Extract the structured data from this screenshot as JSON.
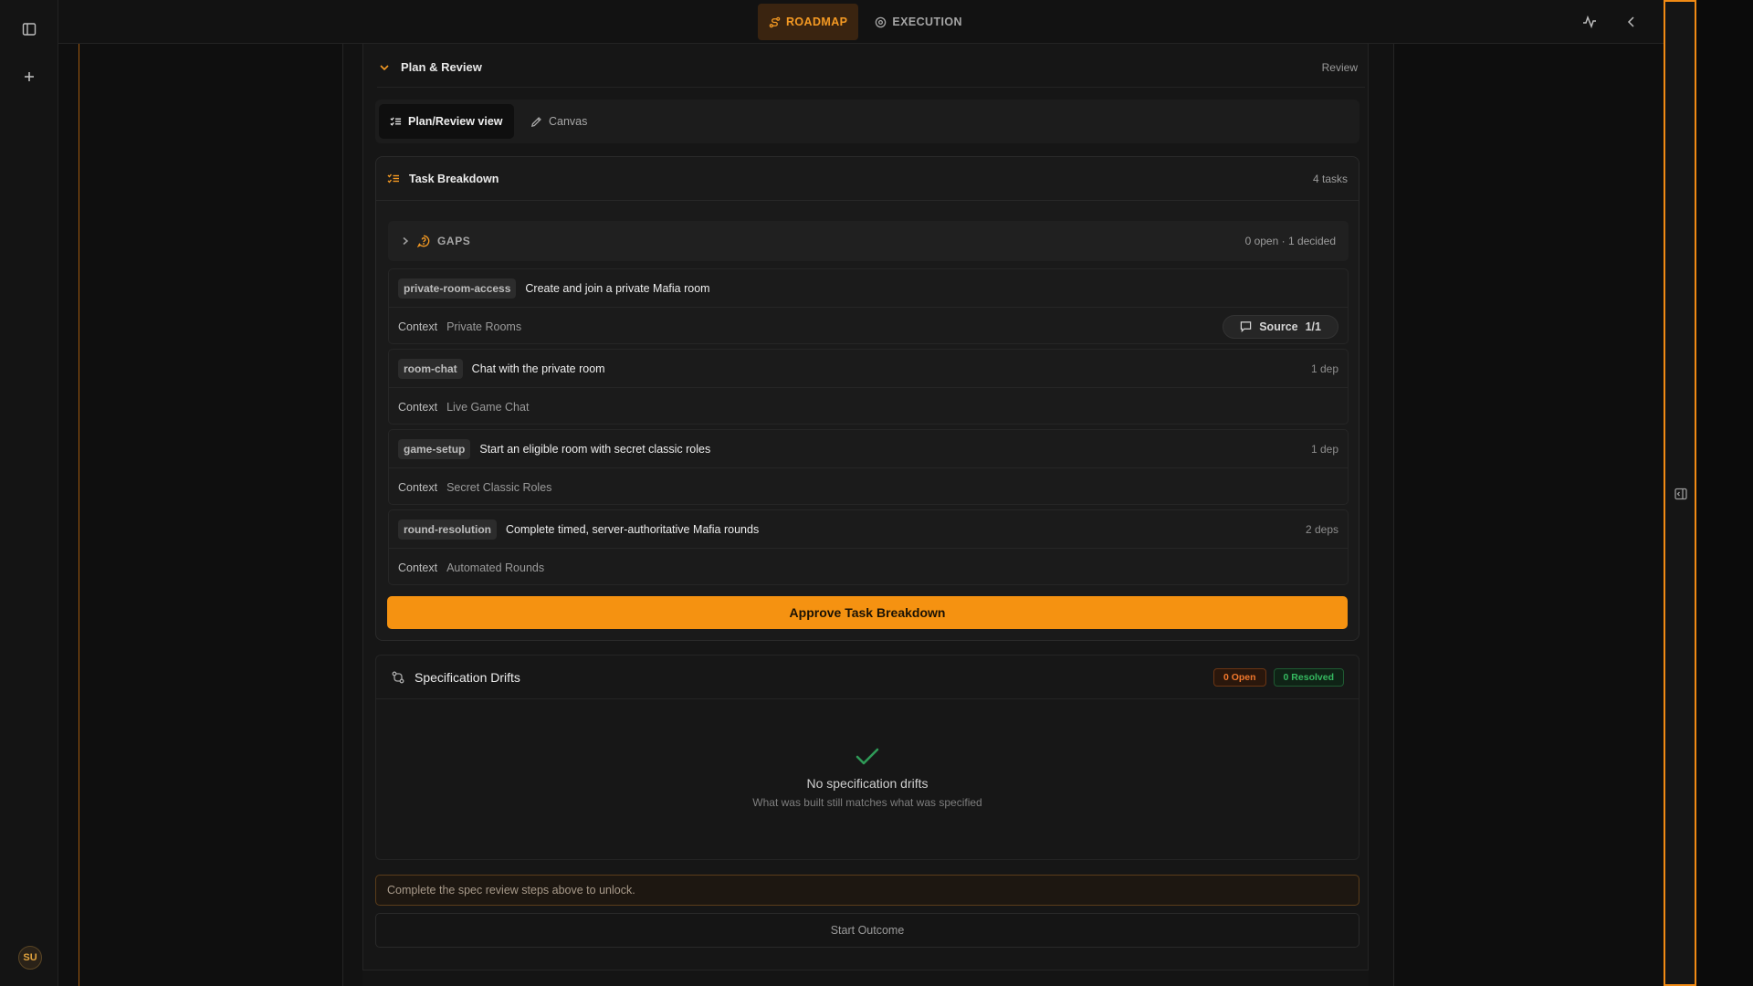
{
  "topbar": {
    "tabs": [
      {
        "label": "ROADMAP",
        "active": true
      },
      {
        "label": "EXECUTION",
        "active": false
      }
    ]
  },
  "rail": {
    "avatar_initials": "SU"
  },
  "plan_review": {
    "title": "Plan & Review",
    "right_label": "Review",
    "views": [
      {
        "label": "Plan/Review view",
        "active": true
      },
      {
        "label": "Canvas",
        "active": false
      }
    ]
  },
  "task_breakdown": {
    "title": "Task Breakdown",
    "count": "4 tasks",
    "gaps": {
      "label": "GAPS",
      "meta": "0 open · 1 decided"
    },
    "context_label": "Context",
    "tasks": [
      {
        "id": "private-room-access",
        "name": "Create and join a private Mafia room",
        "deps": "",
        "context": "Private Rooms",
        "source": "Source",
        "source_count": "1/1"
      },
      {
        "id": "room-chat",
        "name": "Chat with the private room",
        "deps": "1 dep",
        "context": "Live Game Chat"
      },
      {
        "id": "game-setup",
        "name": "Start an eligible room with secret classic roles",
        "deps": "1 dep",
        "context": "Secret Classic Roles"
      },
      {
        "id": "round-resolution",
        "name": "Complete timed, server-authoritative Mafia rounds",
        "deps": "2 deps",
        "context": "Automated Rounds"
      }
    ],
    "approve_label": "Approve Task Breakdown"
  },
  "drifts": {
    "title": "Specification Drifts",
    "open_badge": "0 Open",
    "resolved_badge": "0 Resolved",
    "empty_title": "No specification drifts",
    "empty_sub": "What was built still matches what was specified"
  },
  "outcome": {
    "unlock_note": "Complete the spec review steps above to unlock.",
    "start_label": "Start Outcome"
  },
  "colors": {
    "accent": "#f59211",
    "success": "#35b960",
    "warning": "#f0772c"
  }
}
